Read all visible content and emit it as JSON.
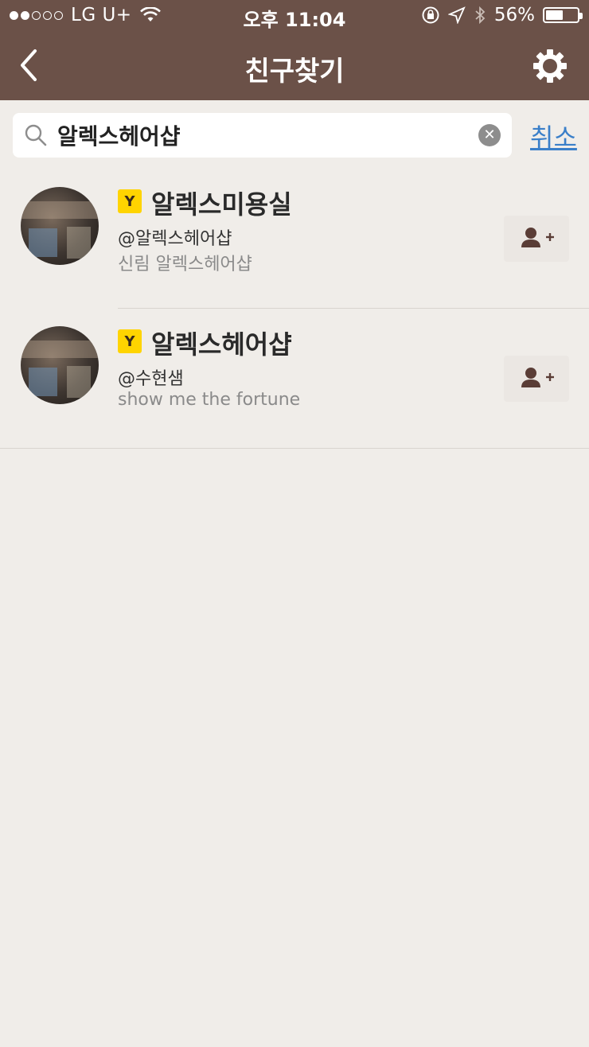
{
  "status_bar": {
    "carrier": "LG U+",
    "time": "오후 11:04",
    "battery": "56%",
    "battery_level": 0.56
  },
  "nav": {
    "title": "친구찾기",
    "back_icon": "chevron-left-icon",
    "settings_icon": "gear-icon"
  },
  "search": {
    "value": "알렉스헤어샵",
    "placeholder": "",
    "cancel_label": "취소"
  },
  "results": [
    {
      "badge": "Y",
      "name": "알렉스미용실",
      "handle": "@알렉스헤어샵",
      "status": "신림 알렉스헤어샵"
    },
    {
      "badge": "Y",
      "name": "알렉스헤어샵",
      "handle": "@수현샘",
      "status": "show me the  fortune"
    }
  ],
  "colors": {
    "header": "#6b5148",
    "background": "#f0ede9",
    "badge": "#ffd400",
    "link": "#3a7fc9"
  }
}
